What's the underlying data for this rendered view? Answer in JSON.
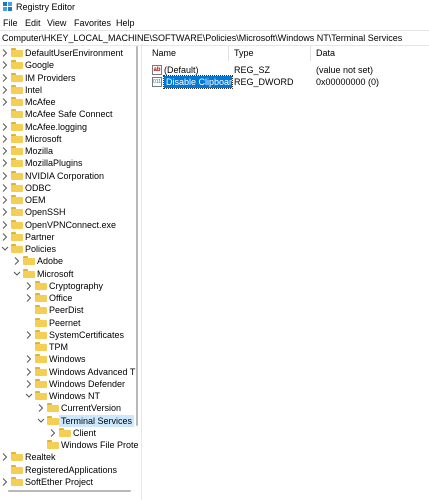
{
  "window": {
    "title": "Registry Editor"
  },
  "menu": [
    "File",
    "Edit",
    "View",
    "Favorites",
    "Help"
  ],
  "address": "Computer\\HKEY_LOCAL_MACHINE\\SOFTWARE\\Policies\\Microsoft\\Windows NT\\Terminal Services",
  "tree": [
    {
      "label": "DefaultUserEnvironment",
      "depth": 0,
      "chevron": "collapsed"
    },
    {
      "label": "Google",
      "depth": 0,
      "chevron": "collapsed"
    },
    {
      "label": "IM Providers",
      "depth": 0,
      "chevron": "collapsed"
    },
    {
      "label": "Intel",
      "depth": 0,
      "chevron": "collapsed"
    },
    {
      "label": "McAfee",
      "depth": 0,
      "chevron": "collapsed"
    },
    {
      "label": "McAfee Safe Connect",
      "depth": 0,
      "chevron": "none"
    },
    {
      "label": "McAfee.logging",
      "depth": 0,
      "chevron": "collapsed"
    },
    {
      "label": "Microsoft",
      "depth": 0,
      "chevron": "collapsed"
    },
    {
      "label": "Mozilla",
      "depth": 0,
      "chevron": "collapsed"
    },
    {
      "label": "MozillaPlugins",
      "depth": 0,
      "chevron": "collapsed"
    },
    {
      "label": "NVIDIA Corporation",
      "depth": 0,
      "chevron": "collapsed"
    },
    {
      "label": "ODBC",
      "depth": 0,
      "chevron": "collapsed"
    },
    {
      "label": "OEM",
      "depth": 0,
      "chevron": "collapsed"
    },
    {
      "label": "OpenSSH",
      "depth": 0,
      "chevron": "collapsed"
    },
    {
      "label": "OpenVPNConnect.exe",
      "depth": 0,
      "chevron": "collapsed"
    },
    {
      "label": "Partner",
      "depth": 0,
      "chevron": "collapsed"
    },
    {
      "label": "Policies",
      "depth": 0,
      "chevron": "expanded"
    },
    {
      "label": "Adobe",
      "depth": 1,
      "chevron": "collapsed"
    },
    {
      "label": "Microsoft",
      "depth": 1,
      "chevron": "expanded"
    },
    {
      "label": "Cryptography",
      "depth": 2,
      "chevron": "collapsed"
    },
    {
      "label": "Office",
      "depth": 2,
      "chevron": "collapsed"
    },
    {
      "label": "PeerDist",
      "depth": 2,
      "chevron": "none"
    },
    {
      "label": "Peernet",
      "depth": 2,
      "chevron": "none"
    },
    {
      "label": "SystemCertificates",
      "depth": 2,
      "chevron": "collapsed"
    },
    {
      "label": "TPM",
      "depth": 2,
      "chevron": "none"
    },
    {
      "label": "Windows",
      "depth": 2,
      "chevron": "collapsed"
    },
    {
      "label": "Windows Advanced Thre",
      "depth": 2,
      "chevron": "collapsed"
    },
    {
      "label": "Windows Defender",
      "depth": 2,
      "chevron": "collapsed"
    },
    {
      "label": "Windows NT",
      "depth": 2,
      "chevron": "expanded"
    },
    {
      "label": "CurrentVersion",
      "depth": 3,
      "chevron": "collapsed"
    },
    {
      "label": "Terminal Services",
      "depth": 3,
      "chevron": "expanded",
      "selected": true
    },
    {
      "label": "Client",
      "depth": 4,
      "chevron": "collapsed"
    },
    {
      "label": "Windows File Protect",
      "depth": 3,
      "chevron": "none"
    },
    {
      "label": "Realtek",
      "depth": 0,
      "chevron": "collapsed"
    },
    {
      "label": "RegisteredApplications",
      "depth": 0,
      "chevron": "none"
    },
    {
      "label": "SoftEther Project",
      "depth": 0,
      "chevron": "collapsed"
    }
  ],
  "list": {
    "columns": [
      "Name",
      "Type",
      "Data"
    ],
    "rows": [
      {
        "icon": "string-value-icon",
        "glyph": "ab",
        "name": "(Default)",
        "type": "REG_SZ",
        "data": "(value not set)"
      },
      {
        "icon": "dword-value-icon",
        "glyph": "011",
        "name": "Disable Clipboar...",
        "type": "REG_DWORD",
        "data": "0x00000000 (0)",
        "selected": true
      }
    ]
  },
  "colors": {
    "selection": "#0078d7",
    "tree_selection": "#cce8ff",
    "folder": "#f5ce55"
  }
}
